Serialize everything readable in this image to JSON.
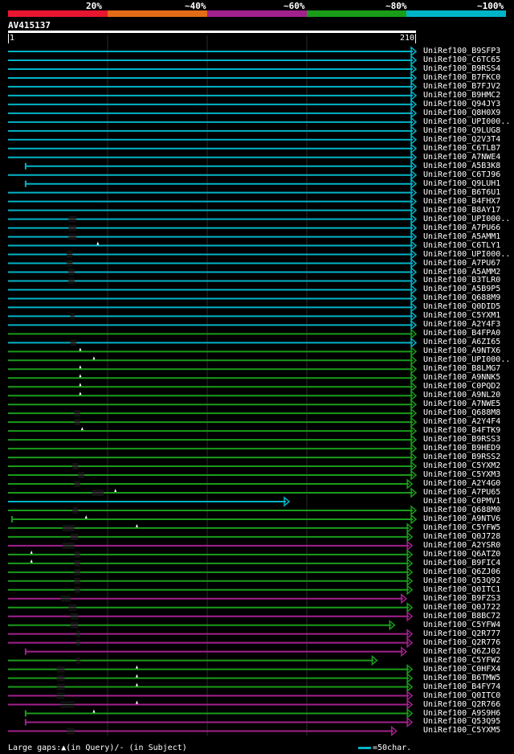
{
  "legend": {
    "labels": [
      "20%",
      "~40%",
      "~60%",
      "~80%",
      "~100%"
    ],
    "colors": [
      "#e8162e",
      "#e46b17",
      "#a3218d",
      "#1a9c1a",
      "#00b4c8"
    ]
  },
  "query": {
    "id": "AV415137",
    "start": "1",
    "end": "210"
  },
  "colors": {
    "c": "#00b4c8",
    "g": "#1a9c1a",
    "m": "#a3218d",
    "gap": "#555555",
    "marker": "#ffffff"
  },
  "hits": [
    {
      "label": "UniRef100_B9SFP3",
      "color": "c",
      "start": 1,
      "end": 210
    },
    {
      "label": "UniRef100_C6TC65",
      "color": "c",
      "start": 1,
      "end": 210
    },
    {
      "label": "UniRef100_B9RSS4",
      "color": "c",
      "start": 1,
      "end": 210
    },
    {
      "label": "UniRef100_B7FKC0",
      "color": "c",
      "start": 1,
      "end": 210
    },
    {
      "label": "UniRef100_B7FJV2",
      "color": "c",
      "start": 1,
      "end": 210
    },
    {
      "label": "UniRef100_B9HMC2",
      "color": "c",
      "start": 1,
      "end": 210
    },
    {
      "label": "UniRef100_Q94JY3",
      "color": "c",
      "start": 1,
      "end": 210
    },
    {
      "label": "UniRef100_Q8H0X9",
      "color": "c",
      "start": 1,
      "end": 210
    },
    {
      "label": "UniRef100_UPI000..",
      "color": "c",
      "start": 1,
      "end": 210
    },
    {
      "label": "UniRef100_Q9LUG8",
      "color": "c",
      "start": 1,
      "end": 210
    },
    {
      "label": "UniRef100_Q2V3T4",
      "color": "c",
      "start": 1,
      "end": 210
    },
    {
      "label": "UniRef100_C6TLB7",
      "color": "c",
      "start": 1,
      "end": 210
    },
    {
      "label": "UniRef100_A7NWE4",
      "color": "c",
      "start": 1,
      "end": 210
    },
    {
      "label": "UniRef100_A5B3K8",
      "color": "c",
      "start": 10,
      "end": 210
    },
    {
      "label": "UniRef100_C6TJ96",
      "color": "c",
      "start": 1,
      "end": 210
    },
    {
      "label": "UniRef100_Q9LUH1",
      "color": "c",
      "start": 10,
      "end": 210
    },
    {
      "label": "UniRef100_B6T6U1",
      "color": "c",
      "start": 1,
      "end": 210
    },
    {
      "label": "UniRef100_B4FHX7",
      "color": "c",
      "start": 1,
      "end": 210
    },
    {
      "label": "UniRef100_B8AY17",
      "color": "c",
      "start": 1,
      "end": 210
    },
    {
      "label": "UniRef100_UPI000..",
      "color": "c",
      "start": 1,
      "end": 210,
      "gap": [
        32,
        36
      ]
    },
    {
      "label": "UniRef100_A7PU66",
      "color": "c",
      "start": 1,
      "end": 210,
      "gap": [
        32,
        36
      ]
    },
    {
      "label": "UniRef100_A5AMM1",
      "color": "c",
      "start": 1,
      "end": 210,
      "gap": [
        32,
        36
      ]
    },
    {
      "label": "UniRef100_C6TLY1",
      "color": "c",
      "start": 1,
      "end": 210,
      "ins": [
        47
      ]
    },
    {
      "label": "UniRef100_UPI000..",
      "color": "c",
      "start": 1,
      "end": 210,
      "gap": [
        31,
        34
      ]
    },
    {
      "label": "UniRef100_A7PU67",
      "color": "c",
      "start": 1,
      "end": 210,
      "gap": [
        31,
        34
      ]
    },
    {
      "label": "UniRef100_A5AMM2",
      "color": "c",
      "start": 1,
      "end": 210,
      "gap": [
        32,
        35
      ]
    },
    {
      "label": "UniRef100_B3TLR0",
      "color": "c",
      "start": 1,
      "end": 210,
      "gap": [
        32,
        35
      ]
    },
    {
      "label": "UniRef100_A5B9P5",
      "color": "c",
      "start": 1,
      "end": 210
    },
    {
      "label": "UniRef100_Q688M9",
      "color": "c",
      "start": 1,
      "end": 210
    },
    {
      "label": "UniRef100_Q0DID5",
      "color": "c",
      "start": 1,
      "end": 210
    },
    {
      "label": "UniRef100_C5YXM1",
      "color": "c",
      "start": 1,
      "end": 210,
      "gap": [
        33,
        35
      ]
    },
    {
      "label": "UniRef100_A2Y4F3",
      "color": "c",
      "start": 1,
      "end": 210
    },
    {
      "label": "UniRef100_B4FPA0",
      "color": "g",
      "start": 1,
      "end": 210
    },
    {
      "label": "UniRef100_A6ZI65",
      "color": "c",
      "start": 1,
      "end": 210,
      "gap": [
        33,
        36
      ]
    },
    {
      "label": "UniRef100_A9NTX6",
      "color": "g",
      "start": 1,
      "end": 210,
      "ins": [
        38
      ]
    },
    {
      "label": "UniRef100_UPI000..",
      "color": "g",
      "start": 1,
      "end": 210,
      "ins": [
        45
      ]
    },
    {
      "label": "UniRef100_B8LMG7",
      "color": "g",
      "start": 1,
      "end": 210,
      "ins": [
        38
      ]
    },
    {
      "label": "UniRef100_A9NNK5",
      "color": "g",
      "start": 1,
      "end": 210,
      "ins": [
        38
      ]
    },
    {
      "label": "UniRef100_C0PQD2",
      "color": "g",
      "start": 1,
      "end": 210,
      "ins": [
        38
      ]
    },
    {
      "label": "UniRef100_A9NL20",
      "color": "g",
      "start": 1,
      "end": 210,
      "ins": [
        38
      ]
    },
    {
      "label": "UniRef100_A7NWE5",
      "color": "g",
      "start": 1,
      "end": 210
    },
    {
      "label": "UniRef100_Q688M8",
      "color": "g",
      "start": 1,
      "end": 210,
      "gap": [
        35,
        38
      ]
    },
    {
      "label": "UniRef100_A2Y4F4",
      "color": "g",
      "start": 1,
      "end": 210,
      "gap": [
        35,
        38
      ]
    },
    {
      "label": "UniRef100_B4FTK9",
      "color": "g",
      "start": 1,
      "end": 210,
      "ins": [
        39
      ]
    },
    {
      "label": "UniRef100_B9RSS3",
      "color": "g",
      "start": 1,
      "end": 210
    },
    {
      "label": "UniRef100_B9HED9",
      "color": "g",
      "start": 1,
      "end": 210
    },
    {
      "label": "UniRef100_B9RSS2",
      "color": "g",
      "start": 1,
      "end": 210
    },
    {
      "label": "UniRef100_C5YXM2",
      "color": "g",
      "start": 1,
      "end": 210,
      "gap": [
        34,
        37
      ]
    },
    {
      "label": "UniRef100_C5YXM3",
      "color": "g",
      "start": 1,
      "end": 210,
      "gap": [
        37,
        40
      ]
    },
    {
      "label": "UniRef100_A2Y4G0",
      "color": "g",
      "start": 1,
      "end": 208,
      "gap": [
        35,
        38
      ]
    },
    {
      "label": "UniRef100_A7PU65",
      "color": "g",
      "start": 1,
      "end": 210,
      "gap": [
        44,
        50
      ],
      "ins": [
        56
      ]
    },
    {
      "label": "UniRef100_C0PMV1",
      "color": "c",
      "start": 1,
      "end": 145
    },
    {
      "label": "UniRef100_Q688M0",
      "color": "g",
      "start": 1,
      "end": 210,
      "gap": [
        34,
        37
      ]
    },
    {
      "label": "UniRef100_A9NTV6",
      "color": "g",
      "start": 3,
      "end": 210,
      "ins": [
        41
      ]
    },
    {
      "label": "UniRef100_C5YFW5",
      "color": "g",
      "start": 1,
      "end": 208,
      "gap": [
        29,
        35
      ],
      "ins": [
        67
      ]
    },
    {
      "label": "UniRef100_Q0J728",
      "color": "g",
      "start": 1,
      "end": 208,
      "gap": [
        33,
        37
      ]
    },
    {
      "label": "UniRef100_A2YSR0",
      "color": "m",
      "start": 1,
      "end": 208,
      "gap": [
        29,
        35
      ]
    },
    {
      "label": "UniRef100_Q6ATZ0",
      "color": "g",
      "start": 1,
      "end": 208,
      "gap": [
        35,
        38
      ],
      "ins": [
        13
      ]
    },
    {
      "label": "UniRef100_B9FIC4",
      "color": "g",
      "start": 1,
      "end": 208,
      "gap": [
        35,
        38
      ],
      "ins": [
        13
      ]
    },
    {
      "label": "UniRef100_Q6ZJ06",
      "color": "g",
      "start": 1,
      "end": 208,
      "gap": [
        35,
        38
      ]
    },
    {
      "label": "UniRef100_Q53Q92",
      "color": "g",
      "start": 1,
      "end": 208,
      "gap": [
        35,
        38
      ]
    },
    {
      "label": "UniRef100_Q0ITC1",
      "color": "g",
      "start": 1,
      "end": 208,
      "gap": [
        35,
        38
      ]
    },
    {
      "label": "UniRef100_B9FZS3",
      "color": "m",
      "start": 1,
      "end": 205,
      "gap": [
        28,
        33
      ]
    },
    {
      "label": "UniRef100_Q0J722",
      "color": "g",
      "start": 1,
      "end": 208,
      "gap": [
        32,
        36
      ]
    },
    {
      "label": "UniRef100_B8BC72",
      "color": "m",
      "start": 1,
      "end": 208,
      "gap": [
        33,
        37
      ]
    },
    {
      "label": "UniRef100_C5YFW4",
      "color": "g",
      "start": 1,
      "end": 199,
      "gap": [
        33,
        37
      ]
    },
    {
      "label": "UniRef100_Q2R777",
      "color": "m",
      "start": 1,
      "end": 208,
      "gap": [
        36,
        38
      ]
    },
    {
      "label": "UniRef100_Q2R776",
      "color": "m",
      "start": 1,
      "end": 208,
      "gap": [
        36,
        38
      ]
    },
    {
      "label": "UniRef100_Q6ZJ02",
      "color": "m",
      "start": 10,
      "end": 205
    },
    {
      "label": "UniRef100_C5YFW2",
      "color": "g",
      "start": 1,
      "end": 190,
      "gap": [
        36,
        38
      ]
    },
    {
      "label": "UniRef100_C0HFX4",
      "color": "g",
      "start": 1,
      "end": 208,
      "gap": [
        26,
        30
      ],
      "ins": [
        67
      ]
    },
    {
      "label": "UniRef100_B6TMW5",
      "color": "g",
      "start": 1,
      "end": 208,
      "gap": [
        26,
        30
      ],
      "ins": [
        67
      ]
    },
    {
      "label": "UniRef100_B4FY74",
      "color": "g",
      "start": 1,
      "end": 208,
      "gap": [
        26,
        30
      ],
      "ins": [
        67
      ]
    },
    {
      "label": "UniRef100_Q0ITC0",
      "color": "m",
      "start": 1,
      "end": 208,
      "gap": [
        26,
        30
      ]
    },
    {
      "label": "UniRef100_Q2R766",
      "color": "m",
      "start": 1,
      "end": 208,
      "gap": [
        28,
        35
      ],
      "ins": [
        67
      ]
    },
    {
      "label": "UniRef100_A9S9H6",
      "color": "g",
      "start": 10,
      "end": 208,
      "ins": [
        45
      ]
    },
    {
      "label": "UniRef100_Q53Q95",
      "color": "m",
      "start": 10,
      "end": 208
    },
    {
      "label": "UniRef100_C5YXM5",
      "color": "m",
      "start": 1,
      "end": 200,
      "gap": [
        31,
        35
      ]
    }
  ],
  "footer": {
    "gaps_text": "Large gaps:▲(in Query)/- (in Subject)",
    "scale_text": "=50char."
  }
}
